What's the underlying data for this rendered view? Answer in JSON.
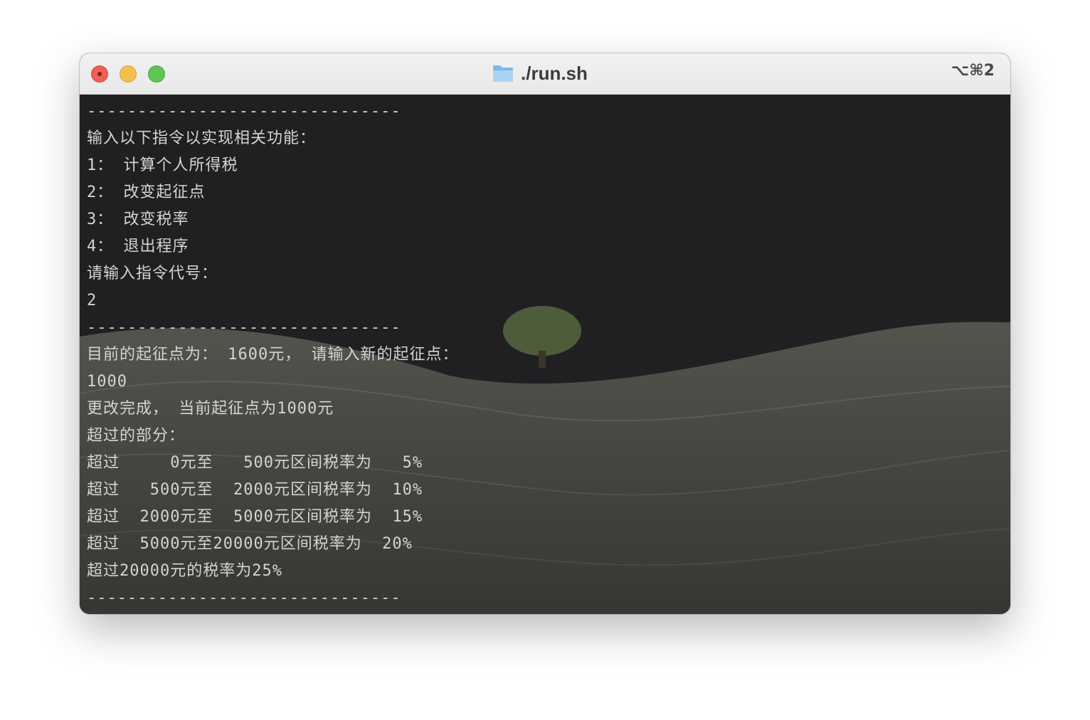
{
  "window": {
    "title": "./run.sh",
    "shortcut": "⌥⌘2"
  },
  "colors": {
    "terminal_bg": "#202023",
    "terminal_text": "#d4d4d4",
    "close": "#ed5f57",
    "minimize": "#f5be4f",
    "zoom": "#61c554",
    "folder": "#8fc3ec"
  },
  "icons": {
    "title": "folder-icon"
  },
  "terminal": {
    "lines": [
      "-------------------------------",
      "输入以下指令以实现相关功能：",
      "1： 计算个人所得税",
      "2： 改变起征点",
      "3： 改变税率",
      "4： 退出程序",
      "请输入指令代号：",
      "2",
      "-------------------------------",
      "目前的起征点为： 1600元， 请输入新的起征点：",
      "1000",
      "更改完成， 当前起征点为1000元",
      "超过的部分：",
      "超过     0元至   500元区间税率为   5%",
      "超过   500元至  2000元区间税率为  10%",
      "超过  2000元至  5000元区间税率为  15%",
      "超过  5000元至20000元区间税率为  20%",
      "超过20000元的税率为25%",
      "-------------------------------"
    ]
  }
}
